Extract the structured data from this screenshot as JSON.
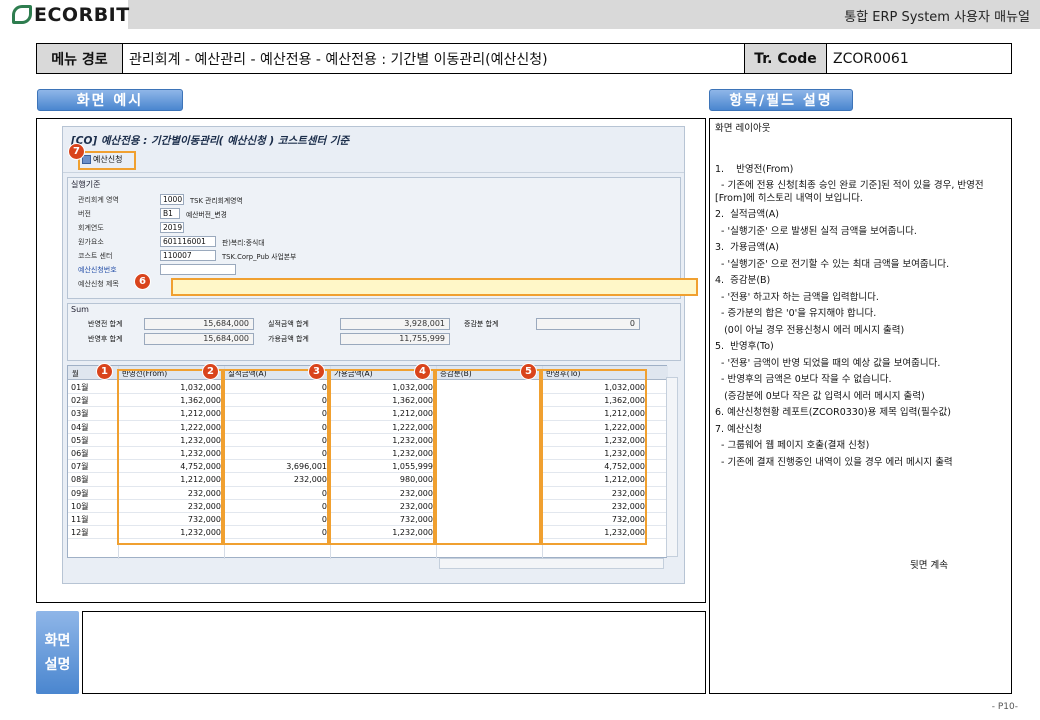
{
  "header": {
    "logo_text": "ECORBIT",
    "doc_title": "통합 ERP System 사용자 매뉴얼"
  },
  "menu": {
    "path_label": "메뉴 경로",
    "path_value": "관리회계 - 예산관리 - 예산전용 - 예산전용 : 기간별 이동관리(예산신청)",
    "tcode_label": "Tr. Code",
    "tcode_value": "ZCOR0061"
  },
  "sections": {
    "screen_example": "화면 예시",
    "field_desc": "항목/필드 설명",
    "screen_desc_1": "화면",
    "screen_desc_2": "설명"
  },
  "sap": {
    "title": "[CO] 예산전용 : 기간별이동관리( 예산신청 ) 코스트센터 기준",
    "toolbar_button": "예산신청",
    "group1_title": "실행기준",
    "fields": [
      {
        "label": "관리회계 영역",
        "value": "1000",
        "desc": "TSK 관리회계영역"
      },
      {
        "label": "버전",
        "value": "B1",
        "desc": "예산버전_변경"
      },
      {
        "label": "회계연도",
        "value": "2019",
        "desc": ""
      },
      {
        "label": "원가요소",
        "value": "601116001",
        "desc": "판)복리:중식대"
      },
      {
        "label": "코스트 센터",
        "value": "110007",
        "desc": "TSK.Corp_Pub 사업본부"
      },
      {
        "label": "예산신청번호",
        "value": "",
        "desc": ""
      },
      {
        "label": "예산신청 제목",
        "value": "",
        "desc": ""
      }
    ],
    "sum": {
      "title": "Sum",
      "before_label": "반영전  합계",
      "before_value": "15,684,000",
      "actual_label": "실적금액 합계",
      "actual_value": "3,928,001",
      "change_label": "증감분  합계",
      "change_value": "0",
      "after_label": "반영후  합계",
      "after_value": "15,684,000",
      "avail_label": "가용금액 합계",
      "avail_value": "11,755,999"
    },
    "grid": {
      "headers": [
        "월",
        "반영전(From)",
        "실적금액(A)",
        "가용금액(A)",
        "증감분(B)",
        "반영후(To)"
      ],
      "rows": [
        [
          "01월",
          "1,032,000",
          "0",
          "1,032,000",
          "",
          "1,032,000"
        ],
        [
          "02월",
          "1,362,000",
          "0",
          "1,362,000",
          "",
          "1,362,000"
        ],
        [
          "03월",
          "1,212,000",
          "0",
          "1,212,000",
          "",
          "1,212,000"
        ],
        [
          "04월",
          "1,222,000",
          "0",
          "1,222,000",
          "",
          "1,222,000"
        ],
        [
          "05월",
          "1,232,000",
          "0",
          "1,232,000",
          "",
          "1,232,000"
        ],
        [
          "06월",
          "1,232,000",
          "0",
          "1,232,000",
          "",
          "1,232,000"
        ],
        [
          "07월",
          "4,752,000",
          "3,696,001",
          "1,055,999",
          "",
          "4,752,000"
        ],
        [
          "08월",
          "1,212,000",
          "232,000",
          "980,000",
          "",
          "1,212,000"
        ],
        [
          "09월",
          "232,000",
          "0",
          "232,000",
          "",
          "232,000"
        ],
        [
          "10월",
          "232,000",
          "0",
          "232,000",
          "",
          "232,000"
        ],
        [
          "11월",
          "732,000",
          "0",
          "732,000",
          "",
          "732,000"
        ],
        [
          "12월",
          "1,232,000",
          "0",
          "1,232,000",
          "",
          "1,232,000"
        ]
      ]
    },
    "markers": [
      "1",
      "2",
      "3",
      "4",
      "5",
      "6",
      "7"
    ]
  },
  "desc_lines": [
    "화면 레이아웃",
    "",
    "1.    반영전(From)",
    "  - 기존에 전용 신청[최종 승인 완료 기준]된 적이 있을 경우, 반영전[From]에 히스토리 내역이 보입니다.",
    "2.  실적금액(A)",
    "  - '실행기준' 으로 발생된 실적 금액을 보여줍니다.",
    "3.  가용금액(A)",
    "  - '실행기준' 으로 전기할 수 있는 최대 금액을 보여줍니다.",
    "4.  증감분(B)",
    "  - '전용' 하고자 하는 금액을 입력합니다.",
    "  - 증가분의 합은 '0'을 유지해야 합니다.",
    "   (0이 아닐 경우 전용신청시 에러 메시지 출력)",
    "5.  반영후(To)",
    "  - '전용' 금액이 반영 되었을 때의 예상 값을 보여줍니다.",
    "  - 반영후의 금액은 0보다 작을 수 없습니다.",
    "   (증감분에 0보다 작은 값 입력시 에러 메시지 출력)",
    "6. 예산신청현황 레포트(ZCOR0330)용 제목 입력(필수값)",
    "7. 예산신청",
    "  - 그룹웨어 웹 페이지 호출(결재 신청)",
    "  - 기존에 결재 진행중인 내역이 있을 경우 에러 메시지 출력"
  ],
  "continue_note": "뒷면 계속",
  "page_number": "- P10-",
  "colors": {
    "highlight": "#f0a030",
    "marker": "#d9441c",
    "pill": "#4a86cf"
  }
}
